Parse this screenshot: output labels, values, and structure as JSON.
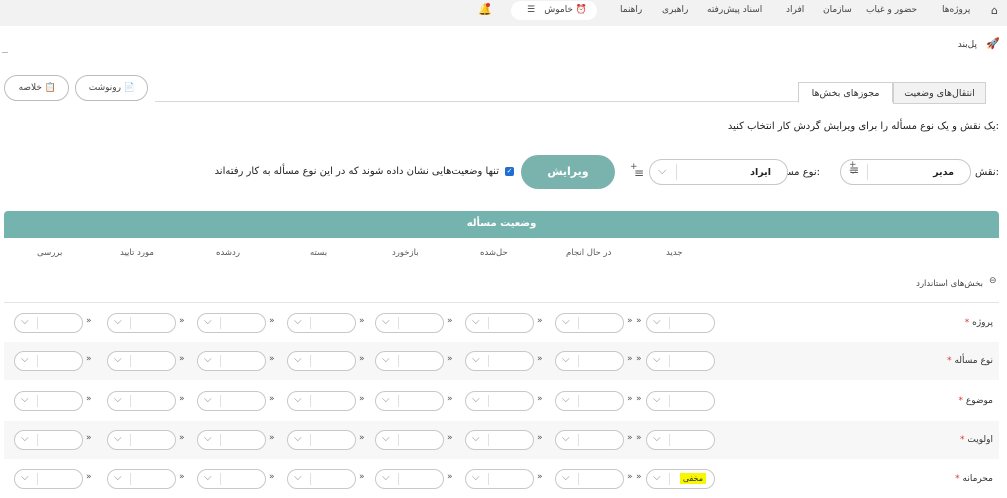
{
  "topbar": {
    "nav": [
      "پروژه‌ها",
      "حضور و غیاب",
      "سازمان",
      "افراد",
      "اسناد پیش‌رفته",
      "راهبری",
      "راهنما"
    ],
    "status_label": "خاموش"
  },
  "page": {
    "title": "پل‌بند",
    "summary_button": "خلاصه",
    "copy_button": "رونوشت",
    "tabs": [
      "انتقال‌های وضعیت",
      "مجوزهای بخش‌ها"
    ],
    "instruction": "یک نقش و یک نوع مسأله را برای ویرایش گردش کار انتخاب کنید:",
    "role_label": "نقش:",
    "role_value": "مدیر",
    "type_label": "نوع مسأله:",
    "type_value": "ایراد",
    "edit_button": "ویرایش",
    "checkbox_label": "تنها وضعیت‌هایی نشان داده شوند که در این نوع مسأله به کار رفته‌اند"
  },
  "grid": {
    "header": "وضعیت مسأله",
    "columns": [
      "جدید",
      "در حال انجام",
      "حل‌شده",
      "بازخورد",
      "بسته",
      "ردشده",
      "مورد تایید",
      "بررسی"
    ],
    "section": "بخش‌های استاندارد",
    "rows": [
      {
        "label": "پروژه",
        "required": "*"
      },
      {
        "label": "نوع مسأله",
        "required": "*"
      },
      {
        "label": "موضوع",
        "required": "*"
      },
      {
        "label": "اولویت",
        "required": "*"
      },
      {
        "label": "محرمانه",
        "required": "*"
      }
    ],
    "highlight_value": "مخفی"
  },
  "colors": {
    "accent": "#75b3ae",
    "highlight": "#f7f700",
    "required": "#dd3333"
  }
}
